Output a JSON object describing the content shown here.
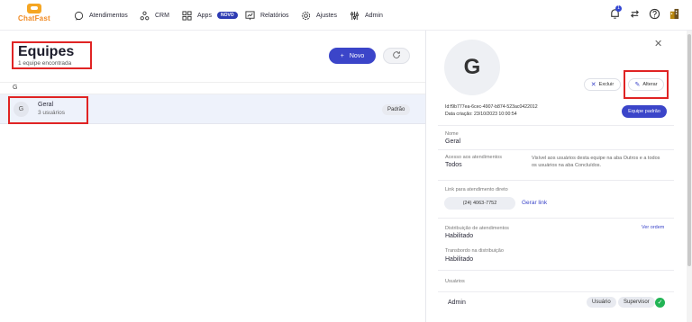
{
  "brand": {
    "name": "ChatFast"
  },
  "nav": [
    {
      "label": "Atendimentos",
      "icon": "chat-bubble-icon"
    },
    {
      "label": "CRM",
      "icon": "crm-nodes-icon"
    },
    {
      "label": "Apps",
      "icon": "apps-grid-icon",
      "badge": "NOVO"
    },
    {
      "label": "Relatórios",
      "icon": "reports-icon"
    },
    {
      "label": "Ajustes",
      "icon": "gear-icon"
    },
    {
      "label": "Admin",
      "icon": "admin-sliders-icon"
    }
  ],
  "header_right": {
    "notification_count": "1"
  },
  "list": {
    "title": "Equipes",
    "subtitle": "1 equipe encontrada",
    "new_button": "Novo",
    "group_letter": "G",
    "rows": [
      {
        "initial": "G",
        "name": "Geral",
        "users": "3 usuários",
        "tag": "Padrão"
      }
    ]
  },
  "detail": {
    "avatar_initial": "G",
    "delete_button": "Excluir",
    "edit_button": "Alterar",
    "id_line": "Id:f9b777ea-6cec-4907-b874-523ac0422012",
    "created_line": "Data criação: 23/10/2023 10:00:54",
    "default_button": "Equipe padrão",
    "name_label": "Nome",
    "name_value": "Geral",
    "access_label": "Acesso aos atendimentos",
    "access_value": "Todos",
    "access_desc": "Visível aos usuários desta equipe na aba Outros e a todos os usuários na aba Concluídos.",
    "link_label": "Link para atendimento direto",
    "phone": "(24) 4063-7752",
    "generate_link": "Gerar link",
    "distribution_label": "Distribuição de atendimentos",
    "distribution_value": "Habilitado",
    "view_order": "Ver ordem",
    "transfer_label": "Transbordo na distribuição",
    "transfer_value": "Habilitado",
    "users_label": "Usuários",
    "users": [
      {
        "name": "Admin",
        "tags": [
          "Usuário",
          "Supervisor"
        ]
      }
    ]
  }
}
